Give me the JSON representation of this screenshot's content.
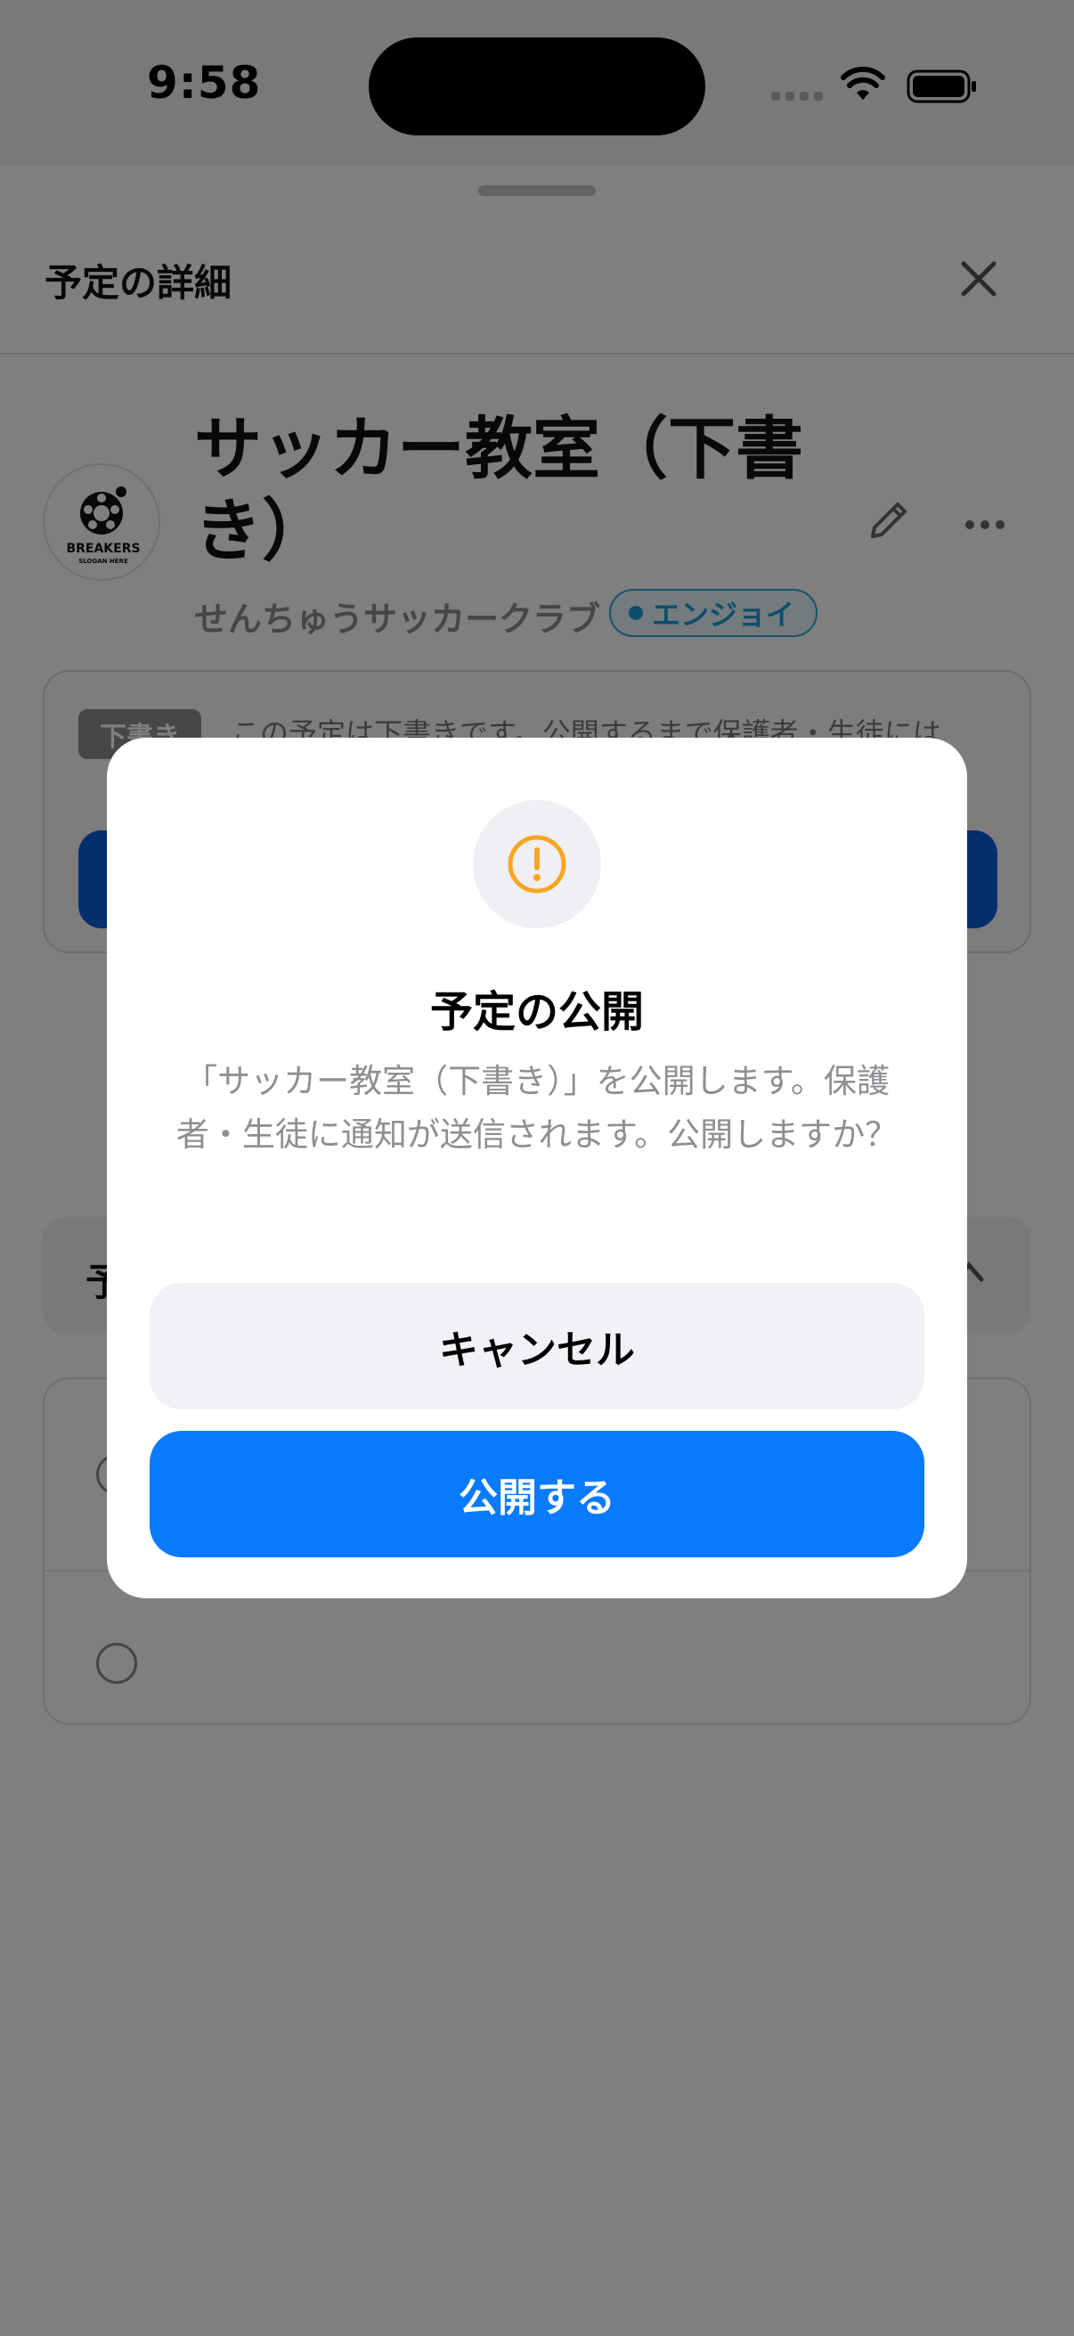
{
  "status_bar": {
    "time": "9:58"
  },
  "sheet": {
    "title": "予定の詳細"
  },
  "event": {
    "title": "サッカー教室（下書き）",
    "club": "せんちゅうサッカークラブ",
    "tag": "エンジョイ",
    "logo_text": "BREAKERS",
    "logo_subtext": "SLOGAN HERE"
  },
  "draft_card": {
    "badge": "下書き",
    "note": "この予定は下書きです。公開するまで保護者・生徒には"
  },
  "section": {
    "label": "予"
  },
  "modal": {
    "title": "予定の公開",
    "message": "「サッカー教室（下書き）」を公開します。保護者・生徒に通知が送信されます。公開しますか？",
    "cancel_label": "キャンセル",
    "publish_label": "公開する"
  },
  "colors": {
    "accent_blue": "#0a7aff",
    "warning_orange": "#f5a623",
    "tag_blue": "#1d9bd7",
    "scrim": "rgba(0,0,0,0.5)"
  },
  "icons": [
    "wifi-icon",
    "battery-icon",
    "close-icon",
    "pencil-icon",
    "more-icon",
    "chevron-up-icon",
    "warning-icon"
  ]
}
